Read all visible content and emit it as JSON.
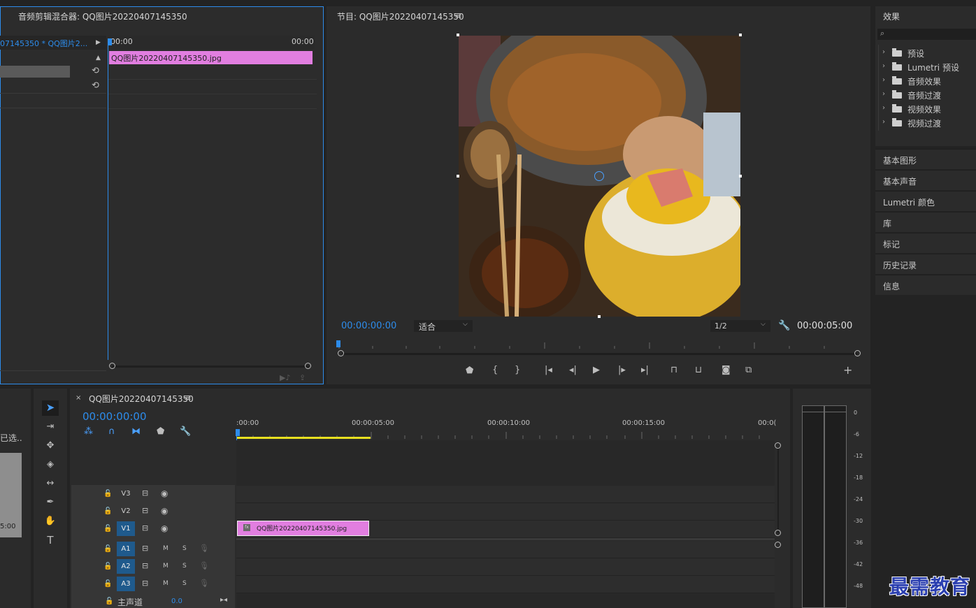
{
  "audio_mixer": {
    "title": "音频剪辑混合器: QQ图片20220407145350",
    "track_name": "07145350 * QQ图片2...",
    "time_start": "00:00",
    "time_end": "00:00",
    "clip_label": "QQ图片20220407145350.jpg"
  },
  "program": {
    "title": "节目: QQ图片20220407145350",
    "timecode": "00:00:00:00",
    "fit_label": "适合",
    "resolution_label": "1/2",
    "duration": "00:00:05:00"
  },
  "effects": {
    "title": "效果",
    "search_placeholder": "",
    "items": [
      {
        "label": "预设"
      },
      {
        "label": "Lumetri 预设"
      },
      {
        "label": "音频效果"
      },
      {
        "label": "音频过渡"
      },
      {
        "label": "视频效果"
      },
      {
        "label": "视频过渡"
      }
    ]
  },
  "side_panels": [
    {
      "label": "基本图形"
    },
    {
      "label": "基本声音"
    },
    {
      "label": "Lumetri 颜色"
    },
    {
      "label": "库"
    },
    {
      "label": "标记"
    },
    {
      "label": "历史记录"
    },
    {
      "label": "信息"
    }
  ],
  "project_left": {
    "selected_label": "已选..",
    "duration_label": "5:00"
  },
  "timeline": {
    "title": "QQ图片20220407145350",
    "timecode": "00:00:00:00",
    "ruler": [
      ":00:00",
      "00:00:05:00",
      "00:00:10:00",
      "00:00:15:00",
      "00:0("
    ],
    "video_tracks": [
      {
        "label": "V3"
      },
      {
        "label": "V2"
      },
      {
        "label": "V1"
      }
    ],
    "audio_tracks": [
      {
        "label": "A1",
        "m": "M",
        "s": "S"
      },
      {
        "label": "A2",
        "m": "M",
        "s": "S"
      },
      {
        "label": "A3",
        "m": "M",
        "s": "S"
      }
    ],
    "master_label": "主声道",
    "master_value": "0.0",
    "clip_label": "QQ图片20220407145350.jpg"
  },
  "meter": {
    "scale": [
      "0",
      "-6",
      "-12",
      "-18",
      "-24",
      "-30",
      "-36",
      "-42",
      "-48"
    ]
  },
  "watermark": "最需教育",
  "colors": {
    "accent": "#2d8ceb",
    "clip_pink": "#e17ee0",
    "track_active": "#1f5a8c",
    "work_area": "#e8e020"
  }
}
